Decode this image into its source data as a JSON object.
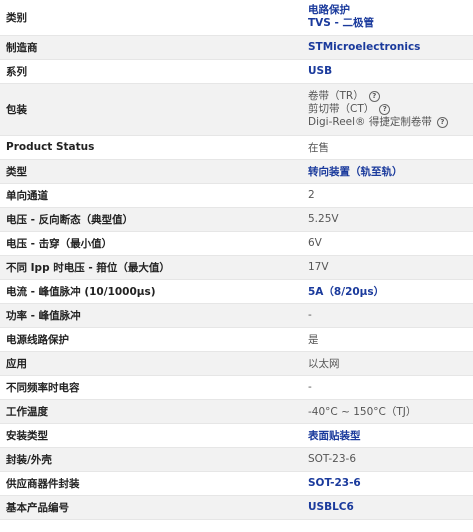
{
  "rows": [
    {
      "key": "类别",
      "lines": [
        "电路保护",
        "TVS - 二极管"
      ],
      "link": true
    },
    {
      "key": "制造商",
      "value": "STMicroelectronics",
      "link": true
    },
    {
      "key": "系列",
      "value": "USB",
      "link": true
    },
    {
      "key": "包装",
      "packaging": [
        {
          "label": "卷带（TR）",
          "help_icon": "question-circle-icon"
        },
        {
          "label": "剪切带（CT）",
          "help_icon": "question-circle-icon"
        },
        {
          "label": "Digi-Reel® 得捷定制卷带",
          "help_icon": "question-circle-icon"
        }
      ]
    },
    {
      "key": "Product Status",
      "value": "在售",
      "link": false
    },
    {
      "key": "类型",
      "value": "转向装置（轨至轨）",
      "link": true
    },
    {
      "key": "单向通道",
      "value": "2",
      "link": false
    },
    {
      "key": "电压 - 反向断态（典型值）",
      "value": "5.25V",
      "link": false
    },
    {
      "key": "电压 - 击穿（最小值）",
      "value": "6V",
      "link": false
    },
    {
      "key": "不同 Ipp 时电压 - 箝位（最大值）",
      "value": "17V",
      "link": false
    },
    {
      "key": "电流 - 峰值脉冲 (10/1000μs)",
      "value": "5A（8/20μs）",
      "link": true
    },
    {
      "key": "功率 - 峰值脉冲",
      "value": "-",
      "link": false
    },
    {
      "key": "电源线路保护",
      "value": "是",
      "link": false
    },
    {
      "key": "应用",
      "value": "以太网",
      "link": false
    },
    {
      "key": "不同频率时电容",
      "value": "-",
      "link": false
    },
    {
      "key": "工作温度",
      "value": "-40°C ~ 150°C（TJ）",
      "link": false
    },
    {
      "key": "安装类型",
      "value": "表面贴装型",
      "link": true
    },
    {
      "key": "封装/外壳",
      "value": "SOT-23-6",
      "link": false
    },
    {
      "key": "供应商器件封装",
      "value": "SOT-23-6",
      "link": true
    },
    {
      "key": "基本产品编号",
      "value": "USBLC6",
      "link": true
    }
  ],
  "colors": {
    "link": "#1a3a9c",
    "row_alt": "#f2f2f2",
    "text": "#222222"
  }
}
